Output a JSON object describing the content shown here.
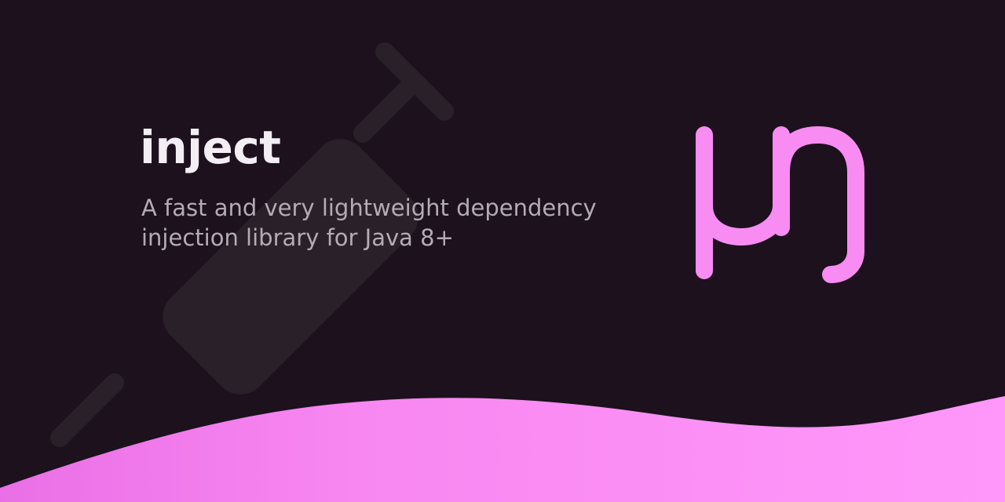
{
  "banner": {
    "title": "inject",
    "subtitle": "A fast and very lightweight dependency\ninjection library for Java 8+"
  },
  "colors": {
    "background": "#1c111d",
    "syringe": "#2a2029",
    "title": "#f3eef3",
    "subtitle": "#b3abb6",
    "logo": "#f88cf2",
    "wave_start": "#ea6fe6",
    "wave_end": "#ff97fa"
  },
  "icons": {
    "background": "syringe-icon",
    "logo": "mu-eng-logo-icon"
  }
}
